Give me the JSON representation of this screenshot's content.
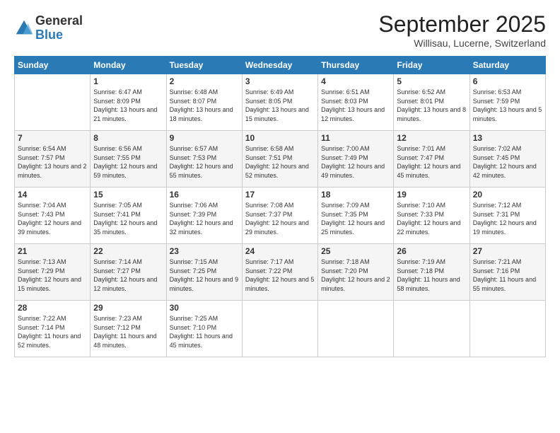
{
  "logo": {
    "general": "General",
    "blue": "Blue"
  },
  "header": {
    "month": "September 2025",
    "location": "Willisau, Lucerne, Switzerland"
  },
  "weekdays": [
    "Sunday",
    "Monday",
    "Tuesday",
    "Wednesday",
    "Thursday",
    "Friday",
    "Saturday"
  ],
  "weeks": [
    [
      {
        "day": "",
        "sunrise": "",
        "sunset": "",
        "daylight": ""
      },
      {
        "day": "1",
        "sunrise": "Sunrise: 6:47 AM",
        "sunset": "Sunset: 8:09 PM",
        "daylight": "Daylight: 13 hours and 21 minutes."
      },
      {
        "day": "2",
        "sunrise": "Sunrise: 6:48 AM",
        "sunset": "Sunset: 8:07 PM",
        "daylight": "Daylight: 13 hours and 18 minutes."
      },
      {
        "day": "3",
        "sunrise": "Sunrise: 6:49 AM",
        "sunset": "Sunset: 8:05 PM",
        "daylight": "Daylight: 13 hours and 15 minutes."
      },
      {
        "day": "4",
        "sunrise": "Sunrise: 6:51 AM",
        "sunset": "Sunset: 8:03 PM",
        "daylight": "Daylight: 13 hours and 12 minutes."
      },
      {
        "day": "5",
        "sunrise": "Sunrise: 6:52 AM",
        "sunset": "Sunset: 8:01 PM",
        "daylight": "Daylight: 13 hours and 8 minutes."
      },
      {
        "day": "6",
        "sunrise": "Sunrise: 6:53 AM",
        "sunset": "Sunset: 7:59 PM",
        "daylight": "Daylight: 13 hours and 5 minutes."
      }
    ],
    [
      {
        "day": "7",
        "sunrise": "Sunrise: 6:54 AM",
        "sunset": "Sunset: 7:57 PM",
        "daylight": "Daylight: 13 hours and 2 minutes."
      },
      {
        "day": "8",
        "sunrise": "Sunrise: 6:56 AM",
        "sunset": "Sunset: 7:55 PM",
        "daylight": "Daylight: 12 hours and 59 minutes."
      },
      {
        "day": "9",
        "sunrise": "Sunrise: 6:57 AM",
        "sunset": "Sunset: 7:53 PM",
        "daylight": "Daylight: 12 hours and 55 minutes."
      },
      {
        "day": "10",
        "sunrise": "Sunrise: 6:58 AM",
        "sunset": "Sunset: 7:51 PM",
        "daylight": "Daylight: 12 hours and 52 minutes."
      },
      {
        "day": "11",
        "sunrise": "Sunrise: 7:00 AM",
        "sunset": "Sunset: 7:49 PM",
        "daylight": "Daylight: 12 hours and 49 minutes."
      },
      {
        "day": "12",
        "sunrise": "Sunrise: 7:01 AM",
        "sunset": "Sunset: 7:47 PM",
        "daylight": "Daylight: 12 hours and 45 minutes."
      },
      {
        "day": "13",
        "sunrise": "Sunrise: 7:02 AM",
        "sunset": "Sunset: 7:45 PM",
        "daylight": "Daylight: 12 hours and 42 minutes."
      }
    ],
    [
      {
        "day": "14",
        "sunrise": "Sunrise: 7:04 AM",
        "sunset": "Sunset: 7:43 PM",
        "daylight": "Daylight: 12 hours and 39 minutes."
      },
      {
        "day": "15",
        "sunrise": "Sunrise: 7:05 AM",
        "sunset": "Sunset: 7:41 PM",
        "daylight": "Daylight: 12 hours and 35 minutes."
      },
      {
        "day": "16",
        "sunrise": "Sunrise: 7:06 AM",
        "sunset": "Sunset: 7:39 PM",
        "daylight": "Daylight: 12 hours and 32 minutes."
      },
      {
        "day": "17",
        "sunrise": "Sunrise: 7:08 AM",
        "sunset": "Sunset: 7:37 PM",
        "daylight": "Daylight: 12 hours and 29 minutes."
      },
      {
        "day": "18",
        "sunrise": "Sunrise: 7:09 AM",
        "sunset": "Sunset: 7:35 PM",
        "daylight": "Daylight: 12 hours and 25 minutes."
      },
      {
        "day": "19",
        "sunrise": "Sunrise: 7:10 AM",
        "sunset": "Sunset: 7:33 PM",
        "daylight": "Daylight: 12 hours and 22 minutes."
      },
      {
        "day": "20",
        "sunrise": "Sunrise: 7:12 AM",
        "sunset": "Sunset: 7:31 PM",
        "daylight": "Daylight: 12 hours and 19 minutes."
      }
    ],
    [
      {
        "day": "21",
        "sunrise": "Sunrise: 7:13 AM",
        "sunset": "Sunset: 7:29 PM",
        "daylight": "Daylight: 12 hours and 15 minutes."
      },
      {
        "day": "22",
        "sunrise": "Sunrise: 7:14 AM",
        "sunset": "Sunset: 7:27 PM",
        "daylight": "Daylight: 12 hours and 12 minutes."
      },
      {
        "day": "23",
        "sunrise": "Sunrise: 7:15 AM",
        "sunset": "Sunset: 7:25 PM",
        "daylight": "Daylight: 12 hours and 9 minutes."
      },
      {
        "day": "24",
        "sunrise": "Sunrise: 7:17 AM",
        "sunset": "Sunset: 7:22 PM",
        "daylight": "Daylight: 12 hours and 5 minutes."
      },
      {
        "day": "25",
        "sunrise": "Sunrise: 7:18 AM",
        "sunset": "Sunset: 7:20 PM",
        "daylight": "Daylight: 12 hours and 2 minutes."
      },
      {
        "day": "26",
        "sunrise": "Sunrise: 7:19 AM",
        "sunset": "Sunset: 7:18 PM",
        "daylight": "Daylight: 11 hours and 58 minutes."
      },
      {
        "day": "27",
        "sunrise": "Sunrise: 7:21 AM",
        "sunset": "Sunset: 7:16 PM",
        "daylight": "Daylight: 11 hours and 55 minutes."
      }
    ],
    [
      {
        "day": "28",
        "sunrise": "Sunrise: 7:22 AM",
        "sunset": "Sunset: 7:14 PM",
        "daylight": "Daylight: 11 hours and 52 minutes."
      },
      {
        "day": "29",
        "sunrise": "Sunrise: 7:23 AM",
        "sunset": "Sunset: 7:12 PM",
        "daylight": "Daylight: 11 hours and 48 minutes."
      },
      {
        "day": "30",
        "sunrise": "Sunrise: 7:25 AM",
        "sunset": "Sunset: 7:10 PM",
        "daylight": "Daylight: 11 hours and 45 minutes."
      },
      {
        "day": "",
        "sunrise": "",
        "sunset": "",
        "daylight": ""
      },
      {
        "day": "",
        "sunrise": "",
        "sunset": "",
        "daylight": ""
      },
      {
        "day": "",
        "sunrise": "",
        "sunset": "",
        "daylight": ""
      },
      {
        "day": "",
        "sunrise": "",
        "sunset": "",
        "daylight": ""
      }
    ]
  ]
}
